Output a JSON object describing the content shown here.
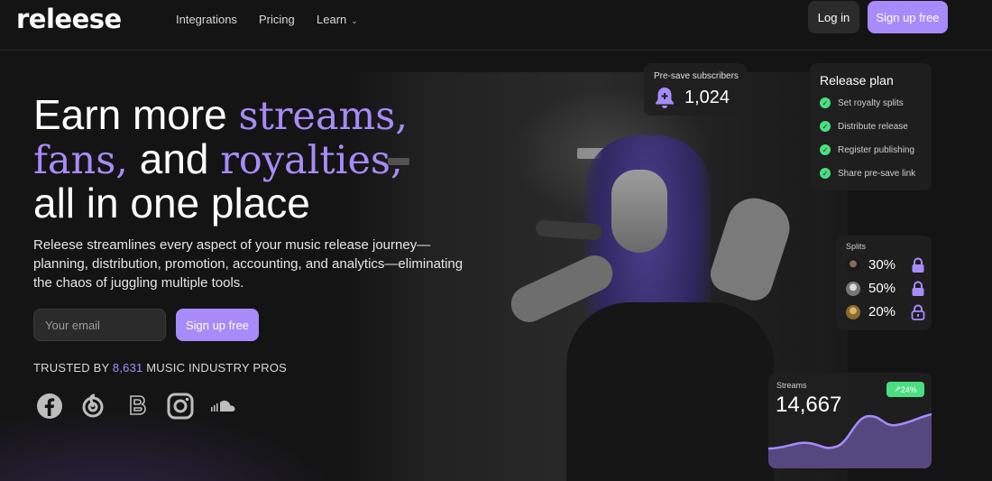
{
  "nav": {
    "logo": "releese",
    "links": [
      "Integrations",
      "Pricing",
      "Learn"
    ],
    "login_label": "Log in",
    "signup_label": "Sign up free"
  },
  "hero": {
    "headline_line1_plain": "Earn more ",
    "headline_line1_accent": "streams,",
    "headline_line2_accent1": "fans,",
    "headline_line2_plain": " and ",
    "headline_line2_accent2": "royalties,",
    "headline_line3": "all in one place",
    "subtitle": "Releese streamlines every aspect of your music release journey—planning, distribution, promotion, accounting, and analytics—eliminating the chaos of juggling multiple tools.",
    "email_placeholder": "Your email",
    "signup_label": "Sign up free",
    "trusted_prefix": "TRUSTED BY ",
    "trusted_count": "8,631",
    "trusted_suffix": " MUSIC INDUSTRY PROS",
    "brand_icons": [
      "facebook-icon",
      "netease-icon",
      "bandcamp-icon",
      "instagram-icon",
      "soundcloud-icon"
    ]
  },
  "presave": {
    "label": "Pre-save subscribers",
    "value": "1,024",
    "icon": "bell-icon"
  },
  "release_plan": {
    "title": "Release plan",
    "items": [
      "Set royalty splits",
      "Distribute release",
      "Register publishing",
      "Share pre-save link"
    ]
  },
  "splits": {
    "title": "Splits",
    "rows": [
      {
        "pct": "30%",
        "locked": true
      },
      {
        "pct": "50%",
        "locked": true
      },
      {
        "pct": "20%",
        "locked": false
      }
    ]
  },
  "streams": {
    "label": "Streams",
    "value": "14,667",
    "change": "24%"
  },
  "colors": {
    "accent": "#a78bfa",
    "success": "#4ade80",
    "background": "#141414",
    "card": "#202020"
  }
}
